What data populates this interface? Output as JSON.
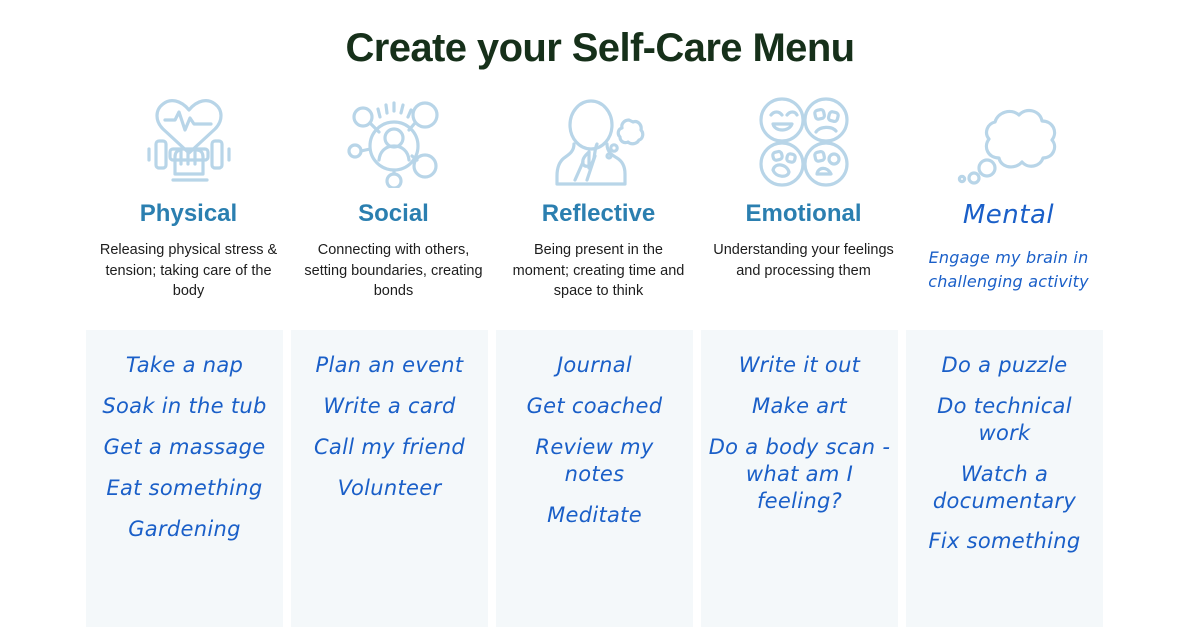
{
  "page": {
    "title": "Create your Self-Care Menu",
    "background_color": "#ffffff",
    "title_color": "#16301a",
    "heading_color": "#2b7fb0",
    "hand_color": "#1a5fc8",
    "panel_color": "#f4f8fa",
    "icon_color": "#b8d5e8"
  },
  "columns": [
    {
      "id": "physical",
      "icon": "heartbeat-dumbbell-icon",
      "heading": "Physical",
      "description": "Releasing physical stress & tension; taking care of the body",
      "style": "print",
      "items": [
        "Take a nap",
        "Soak in the tub",
        "Get a massage",
        "Eat something",
        "Gardening"
      ]
    },
    {
      "id": "social",
      "icon": "people-network-icon",
      "heading": "Social",
      "description": "Connecting with others, setting boundaries, creating bonds",
      "style": "print",
      "items": [
        "Plan an event",
        "Write a card",
        "Call my friend",
        "Volunteer"
      ]
    },
    {
      "id": "reflective",
      "icon": "thinking-person-icon",
      "heading": "Reflective",
      "description": "Being present in the moment; creating time and space to think",
      "style": "print",
      "items": [
        "Journal",
        "Get coached",
        "Review my notes",
        "Meditate"
      ]
    },
    {
      "id": "emotional",
      "icon": "emotion-faces-icon",
      "heading": "Emotional",
      "description": "Understanding your feelings and processing them",
      "style": "print",
      "items": [
        "Write it out",
        "Make art",
        "Do a body scan - what am I feeling?"
      ]
    },
    {
      "id": "mental",
      "icon": "thought-cloud-icon",
      "heading": "Mental",
      "description": "Engage my brain in challenging activity",
      "style": "handwritten",
      "items": [
        "Do a puzzle",
        "Do technical work",
        "Watch a documentary",
        "Fix something"
      ]
    }
  ]
}
